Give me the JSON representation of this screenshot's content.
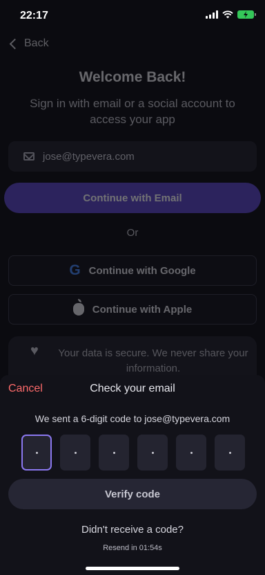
{
  "status_bar": {
    "time": "22:17",
    "icons": [
      "signal-icon",
      "wifi-icon",
      "battery-charging-icon"
    ],
    "battery_color": "#34c759"
  },
  "background": {
    "back_label": "Back",
    "title": "Welcome Back!",
    "subtitle": "Sign in with email or a social account to access your app",
    "email_value": "jose@typevera.com",
    "continue_email_label": "Continue with Email",
    "or_label": "Or",
    "google_label": "Continue with Google",
    "apple_label": "Continue with Apple",
    "secure_text": "Your data is secure. We never share your information."
  },
  "sheet": {
    "cancel_label": "Cancel",
    "title": "Check your email",
    "message": "We sent a 6-digit code to jose@typevera.com",
    "code_digits": [
      "",
      "",
      "",
      "",
      "",
      ""
    ],
    "active_digit_index": 0,
    "verify_label": "Verify code",
    "no_code_text": "Didn't receive a code?",
    "resend_text": "Resend in 01:54s"
  },
  "colors": {
    "accent": "#5a46c8",
    "active_border": "#8b78f0",
    "cancel": "#ff6b6b"
  }
}
